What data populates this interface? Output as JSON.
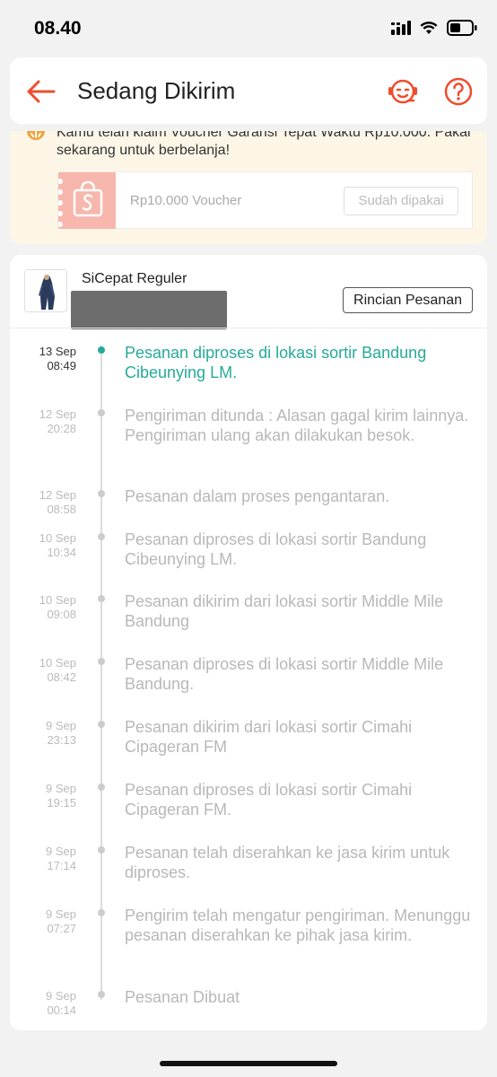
{
  "status_bar": {
    "time": "08.40"
  },
  "header": {
    "title": "Sedang Dikirim"
  },
  "voucher": {
    "message": "Kamu telah klaim Voucher Garansi Tepat Waktu Rp10.000. Pakai sekarang untuk berbelanja!",
    "label": "Rp10.000 Voucher",
    "button": "Sudah dipakai"
  },
  "shipment": {
    "courier": "SiCepat Reguler",
    "detail_button": "Rincian Pesanan"
  },
  "events": [
    {
      "date": "13 Sep",
      "time": "08:49",
      "desc": "Pesanan diproses di lokasi sortir  Bandung Cibeunying LM."
    },
    {
      "date": "12 Sep",
      "time": "20:28",
      "desc": "Pengiriman ditunda : Alasan gagal kirim lainnya. Pengiriman ulang akan dilakukan besok."
    },
    {
      "date": "12 Sep",
      "time": "08:58",
      "desc": "Pesanan dalam proses pengantaran."
    },
    {
      "date": "10 Sep",
      "time": "10:34",
      "desc": "Pesanan diproses di lokasi sortir  Bandung Cibeunying LM."
    },
    {
      "date": "10 Sep",
      "time": "09:08",
      "desc": "Pesanan dikirim dari lokasi sortir  Middle Mile Bandung"
    },
    {
      "date": "10 Sep",
      "time": "08:42",
      "desc": "Pesanan diproses di lokasi sortir  Middle Mile Bandung."
    },
    {
      "date": "9 Sep",
      "time": "23:13",
      "desc": "Pesanan dikirim dari lokasi sortir  Cimahi Cipageran FM"
    },
    {
      "date": "9 Sep",
      "time": "19:15",
      "desc": "Pesanan diproses di lokasi sortir  Cimahi Cipageran FM."
    },
    {
      "date": "9 Sep",
      "time": "17:14",
      "desc": "Pesanan telah diserahkan ke jasa kirim untuk diproses."
    },
    {
      "date": "9 Sep",
      "time": "07:27",
      "desc": "Pengirim telah mengatur pengiriman. Menunggu pesanan diserahkan ke pihak jasa kirim."
    },
    {
      "date": "9 Sep",
      "time": "00:14",
      "desc": "Pesanan Dibuat"
    }
  ],
  "colors": {
    "accent": "#ee4d2d",
    "active_event": "#26aa99",
    "voucher_banner": "#fdf6e6"
  },
  "icons": [
    "back-arrow-icon",
    "chat-support-icon",
    "help-icon",
    "shopee-bag-icon",
    "voucher-clock-icon",
    "signal-icon",
    "wifi-icon",
    "battery-icon"
  ]
}
